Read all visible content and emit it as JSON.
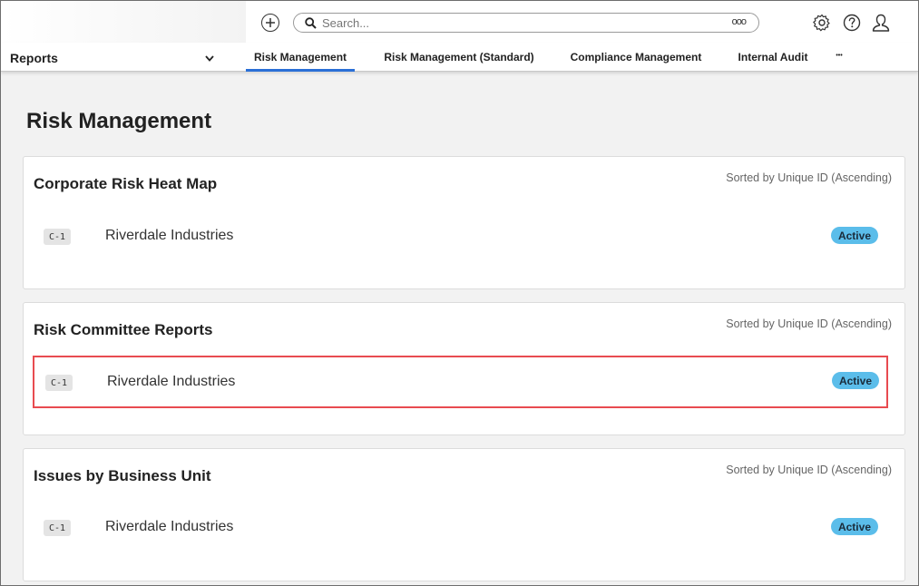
{
  "header": {
    "search_placeholder": "Search...",
    "more_label": "ooo"
  },
  "nav": {
    "reports_label": "Reports",
    "tabs": [
      {
        "label": "Risk Management"
      },
      {
        "label": "Risk Management (Standard)"
      },
      {
        "label": "Compliance Management"
      },
      {
        "label": "Internal Audit"
      },
      {
        "label": "•••"
      }
    ]
  },
  "page": {
    "title": "Risk Management"
  },
  "cards": [
    {
      "title": "Corporate Risk Heat Map",
      "sort": "Sorted by Unique ID (Ascending)",
      "row": {
        "id": "C-1",
        "name": "Riverdale Industries",
        "status": "Active"
      }
    },
    {
      "title": "Risk Committee Reports",
      "sort": "Sorted by Unique ID (Ascending)",
      "row": {
        "id": "C-1",
        "name": "Riverdale Industries",
        "status": "Active"
      }
    },
    {
      "title": "Issues by Business Unit",
      "sort": "Sorted by Unique ID (Ascending)",
      "row": {
        "id": "C-1",
        "name": "Riverdale Industries",
        "status": "Active"
      }
    }
  ],
  "colors": {
    "accent": "#2a6fd6",
    "status_active": "#5bbdea",
    "highlight": "#e84b50",
    "background": "#f2f2f2"
  },
  "icons": [
    "add-icon",
    "search-icon",
    "gear-icon",
    "help-icon",
    "user-icon",
    "chevron-down-icon"
  ]
}
